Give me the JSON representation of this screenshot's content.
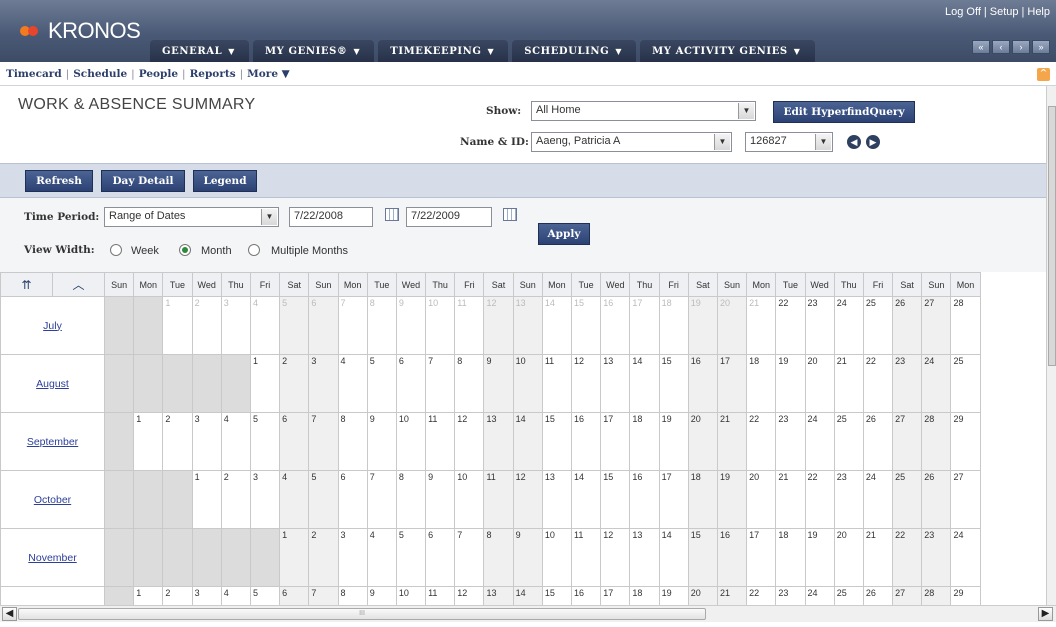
{
  "header": {
    "logo_text": "KRONOS",
    "top_links": [
      "Log Off",
      "Setup",
      "Help"
    ],
    "menus": [
      "GENERAL",
      "MY GENIES®",
      "TIMEKEEPING",
      "SCHEDULING",
      "MY ACTIVITY GENIES"
    ],
    "nav_buttons": [
      "«",
      "‹",
      "›",
      "»"
    ]
  },
  "subnav": {
    "items": [
      "Timecard",
      "Schedule",
      "People",
      "Reports",
      "More ▼"
    ]
  },
  "page": {
    "title": "WORK & ABSENCE SUMMARY"
  },
  "show": {
    "label": "Show:",
    "value": "All Home",
    "edit_button": "Edit HyperfindQuery"
  },
  "name_id": {
    "label": "Name & ID:",
    "name": "Aaeng, Patricia A",
    "id": "126827"
  },
  "toolbar": {
    "refresh": "Refresh",
    "day_detail": "Day Detail",
    "legend": "Legend"
  },
  "time_period": {
    "label": "Time Period:",
    "value": "Range of Dates",
    "start": "7/22/2008",
    "end": "7/22/2009",
    "apply": "Apply"
  },
  "view_width": {
    "label": "View Width:",
    "options": [
      "Week",
      "Month",
      "Multiple Months"
    ],
    "selected": "Month"
  },
  "calendar": {
    "day_headers": [
      "Sun",
      "Mon",
      "Tue",
      "Wed",
      "Thu",
      "Fri",
      "Sat",
      "Sun",
      "Mon",
      "Tue",
      "Wed",
      "Thu",
      "Fri",
      "Sat",
      "Sun",
      "Mon",
      "Tue",
      "Wed",
      "Thu",
      "Fri",
      "Sat",
      "Sun",
      "Mon",
      "Tue",
      "Wed",
      "Thu",
      "Fri",
      "Sat",
      "Sun",
      "Mon"
    ],
    "months": [
      {
        "name": "July",
        "offset": 2,
        "days": 31,
        "past_until": 21
      },
      {
        "name": "August",
        "offset": 5,
        "days": 31,
        "past_until": 0
      },
      {
        "name": "September",
        "offset": 1,
        "days": 30,
        "past_until": 0
      },
      {
        "name": "October",
        "offset": 3,
        "days": 31,
        "past_until": 0
      },
      {
        "name": "November",
        "offset": 6,
        "days": 30,
        "past_until": 0
      },
      {
        "name": "",
        "offset": 1,
        "days": 30,
        "past_until": 0
      }
    ]
  },
  "scroll": {
    "middle_mark": "III"
  }
}
